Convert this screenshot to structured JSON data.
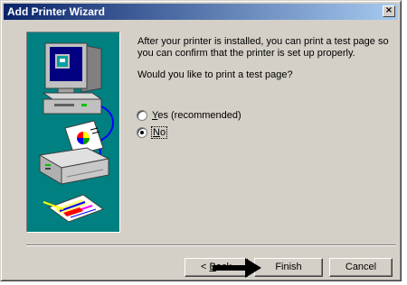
{
  "window": {
    "title": "Add Printer Wizard",
    "close_glyph": "×"
  },
  "content": {
    "instruction": "After your printer is installed, you can print a test page so you can confirm that the printer is set up properly.",
    "question": "Would you like to print a test page?"
  },
  "options": [
    {
      "mnemonic": "Y",
      "rest": "es (recommended)",
      "selected": false
    },
    {
      "mnemonic": "N",
      "rest": "o",
      "selected": true
    }
  ],
  "buttons": {
    "back_prefix": "< ",
    "back_mnemonic": "B",
    "back_rest": "ack",
    "finish": "Finish",
    "cancel": "Cancel"
  },
  "icons": {
    "illustration": "computer-printer-illustration",
    "cursor": "pointer-arrow-icon"
  },
  "colors": {
    "titlebar_start": "#0a246a",
    "titlebar_end": "#a6caf0",
    "face": "#d4d0c8",
    "illustration_bg": "#008080"
  }
}
